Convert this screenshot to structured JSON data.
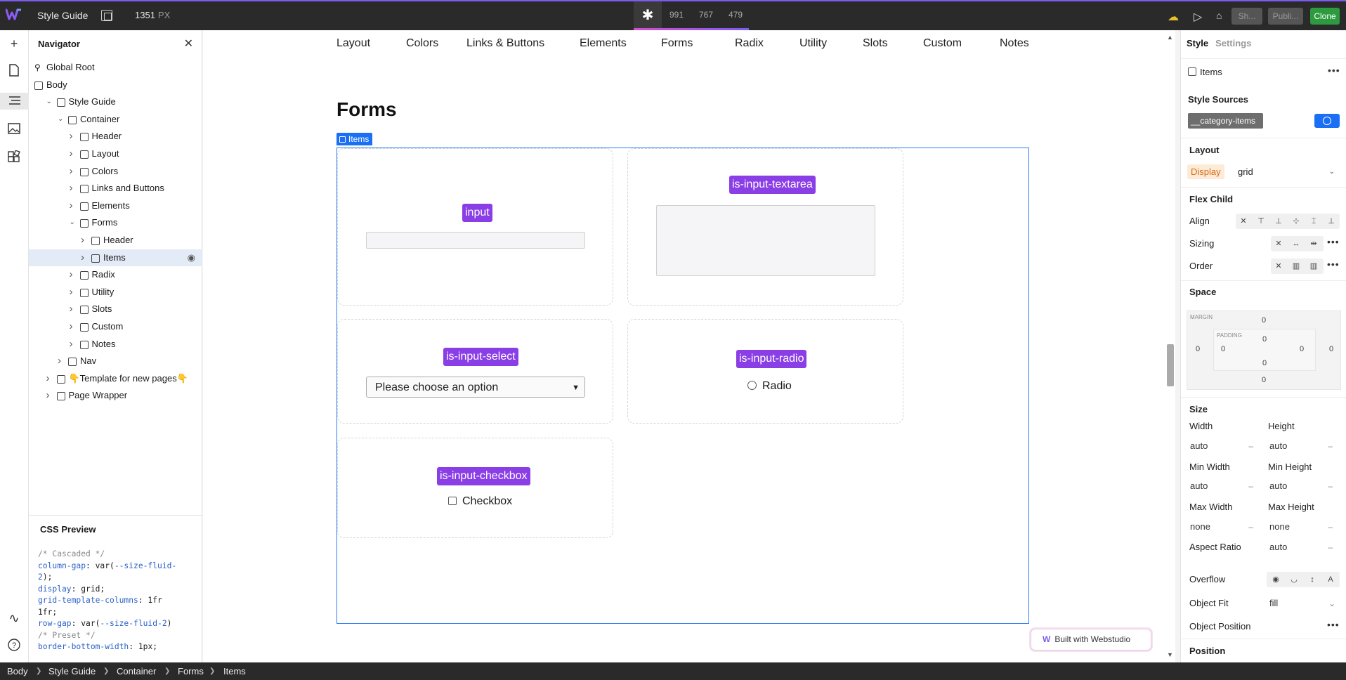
{
  "topbar": {
    "title": "Style Guide",
    "width_value": "1351",
    "width_unit": "PX",
    "breakpoints": [
      "991",
      "767",
      "479"
    ],
    "buttons": {
      "share": "Sh...",
      "publish": "Publi...",
      "clone": "Clone"
    },
    "colors": {
      "accent": "#7b5cf0",
      "clone": "#2d9a3f"
    }
  },
  "rail": {
    "icons": [
      "plus-icon",
      "page-icon",
      "navigator-icon",
      "image-icon",
      "components-icon",
      "wave-icon",
      "help-icon"
    ]
  },
  "navigator": {
    "title": "Navigator",
    "tree": [
      {
        "label": "Global Root",
        "depth": 0,
        "chevron": false,
        "icon": "global"
      },
      {
        "label": "Body",
        "depth": 0,
        "chevron": false,
        "icon": "body"
      },
      {
        "label": "Style Guide",
        "depth": 1,
        "chevron": "open"
      },
      {
        "label": "Container",
        "depth": 2,
        "chevron": "open"
      },
      {
        "label": "Header",
        "depth": 3,
        "chevron": "closed"
      },
      {
        "label": "Layout",
        "depth": 3,
        "chevron": "closed"
      },
      {
        "label": "Colors",
        "depth": 3,
        "chevron": "closed"
      },
      {
        "label": "Links and Buttons",
        "depth": 3,
        "chevron": "closed"
      },
      {
        "label": "Elements",
        "depth": 3,
        "chevron": "closed"
      },
      {
        "label": "Forms",
        "depth": 3,
        "chevron": "open"
      },
      {
        "label": "Header",
        "depth": 4,
        "chevron": "closed"
      },
      {
        "label": "Items",
        "depth": 4,
        "chevron": "closed",
        "selected": true
      },
      {
        "label": "Radix",
        "depth": 3,
        "chevron": "closed"
      },
      {
        "label": "Utility",
        "depth": 3,
        "chevron": "closed"
      },
      {
        "label": "Slots",
        "depth": 3,
        "chevron": "closed"
      },
      {
        "label": "Custom",
        "depth": 3,
        "chevron": "closed"
      },
      {
        "label": "Notes",
        "depth": 3,
        "chevron": "closed"
      },
      {
        "label": "Nav",
        "depth": 2,
        "chevron": "closed"
      },
      {
        "label": "👇Template for new pages👇",
        "depth": 1,
        "chevron": "closed"
      },
      {
        "label": "Page Wrapper",
        "depth": 1,
        "chevron": "closed"
      }
    ],
    "css_preview": {
      "title": "CSS Preview",
      "lines": [
        [
          {
            "t": "/* Cascaded */",
            "c": "cm"
          }
        ],
        [
          {
            "t": "column-gap",
            "c": "pr"
          },
          {
            "t": ": var(",
            "c": "vl"
          },
          {
            "t": "--size-fluid-",
            "c": "pr"
          }
        ],
        [
          {
            "t": "2",
            "c": "pr"
          },
          {
            "t": ");",
            "c": "vl"
          }
        ],
        [
          {
            "t": "display",
            "c": "pr"
          },
          {
            "t": ": grid;",
            "c": "vl"
          }
        ],
        [
          {
            "t": "grid-template-columns",
            "c": "pr"
          },
          {
            "t": ": 1fr",
            "c": "vl"
          }
        ],
        [
          {
            "t": "1fr",
            "c": "vl"
          },
          {
            "t": ";",
            "c": "vl"
          }
        ],
        [
          {
            "t": "row-gap",
            "c": "pr"
          },
          {
            "t": ": var(",
            "c": "vl"
          },
          {
            "t": "--size-fluid-2",
            "c": "pr"
          },
          {
            "t": ")",
            "c": "vl"
          }
        ],
        [
          {
            "t": "/* Preset */",
            "c": "cm"
          }
        ],
        [
          {
            "t": "border-bottom-width",
            "c": "pr"
          },
          {
            "t": ": 1px;",
            "c": "vl"
          }
        ]
      ]
    }
  },
  "canvas": {
    "nav_links": [
      "Layout",
      "Colors",
      "Links & Buttons",
      "Elements",
      "Forms",
      "Radix",
      "Utility",
      "Slots",
      "Custom",
      "Notes"
    ],
    "heading": "Forms",
    "selected_tag": "Items",
    "cells": {
      "input": "input",
      "textarea": "is-input-textarea",
      "select": "is-input-select",
      "select_value": "Please choose an option",
      "radio": "is-input-radio",
      "radio_label": "Radio",
      "checkbox": "is-input-checkbox",
      "checkbox_label": "Checkbox"
    },
    "built_with": "Built with Webstudio",
    "colors": {
      "pill": "#8a3ee6",
      "selection": "#2f7bf5"
    }
  },
  "right_panel": {
    "tabs": [
      "Style",
      "Settings"
    ],
    "instance": "Items",
    "style_sources_label": "Style Sources",
    "style_source_tag": "__category-items",
    "layout": {
      "title": "Layout",
      "display_label": "Display",
      "display_value": "grid"
    },
    "flex_child": {
      "title": "Flex Child",
      "align": "Align",
      "sizing": "Sizing",
      "order": "Order"
    },
    "space": {
      "title": "Space",
      "margin_label": "MARGIN",
      "padding_label": "PADDING",
      "margin": [
        "0",
        "0",
        "0",
        "0"
      ],
      "padding": [
        "0",
        "0",
        "0",
        "0"
      ]
    },
    "size": {
      "title": "Size",
      "width": "Width",
      "width_v": "auto",
      "height": "Height",
      "height_v": "auto",
      "min_width": "Min Width",
      "min_width_v": "auto",
      "min_height": "Min Height",
      "min_height_v": "auto",
      "max_width": "Max Width",
      "max_width_v": "none",
      "max_height": "Max Height",
      "max_height_v": "none",
      "aspect": "Aspect Ratio",
      "aspect_v": "auto",
      "overflow": "Overflow",
      "object_fit": "Object Fit",
      "object_fit_v": "fill",
      "object_position": "Object Position"
    },
    "position_title": "Position"
  },
  "breadcrumb": [
    "Body",
    "Style Guide",
    "Container",
    "Forms",
    "Items"
  ]
}
